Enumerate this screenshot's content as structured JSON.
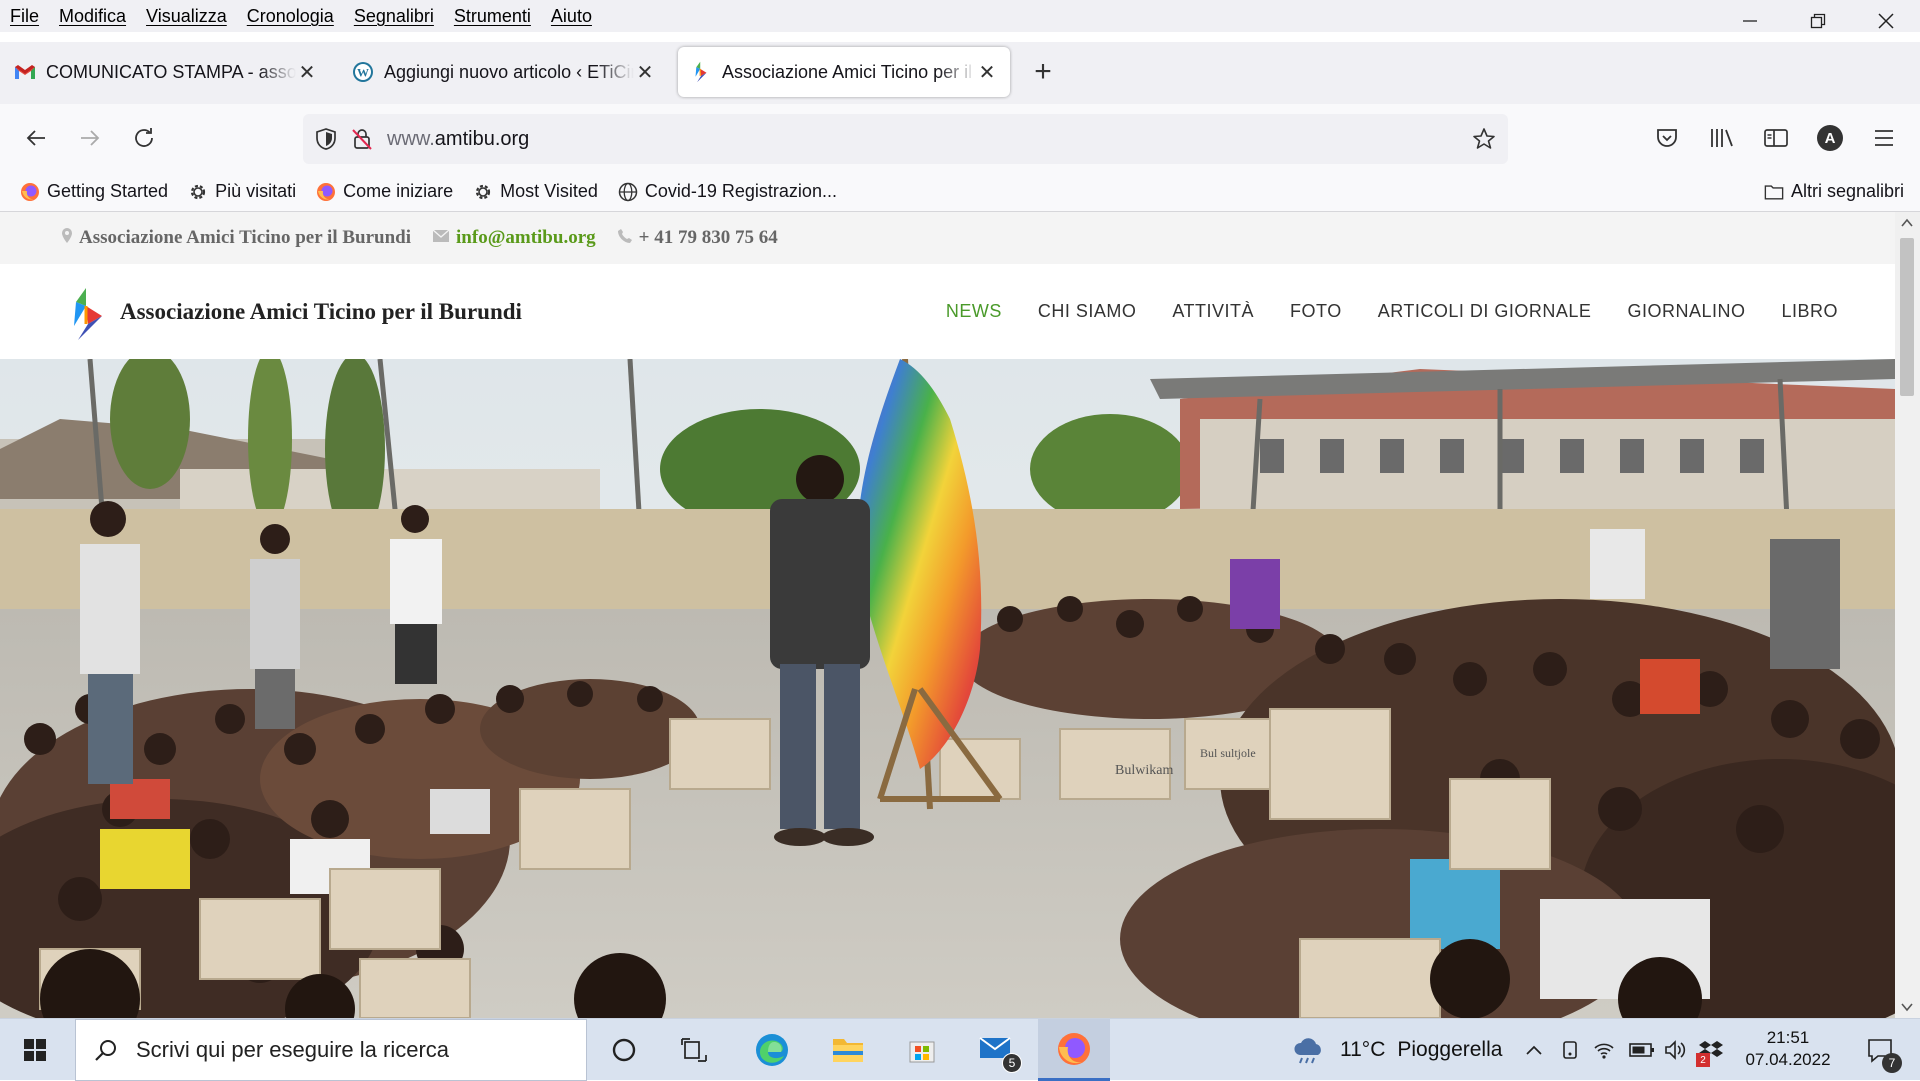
{
  "menu": [
    "File",
    "Modifica",
    "Visualizza",
    "Cronologia",
    "Segnalibri",
    "Strumenti",
    "Aiuto"
  ],
  "window_controls": {
    "minimize": "—",
    "restore": "❐",
    "close": "✕"
  },
  "tabs": [
    {
      "title": "COMUNICATO STAMPA - associ",
      "icon": "gmail-icon",
      "close": "✕"
    },
    {
      "title": "Aggiungi nuovo articolo ‹ ETiCin",
      "icon": "wordpress-icon",
      "close": "✕"
    },
    {
      "title": "Associazione Amici Ticino per il Burundi",
      "icon": "site-logo-icon",
      "close": "✕"
    }
  ],
  "new_tab_label": "+",
  "url": {
    "prefix": "www.",
    "domain": "amtibu.org"
  },
  "bookmarks": [
    {
      "label": "Getting Started",
      "icon": "firefox-icon"
    },
    {
      "label": "Più visitati",
      "icon": "gear-icon"
    },
    {
      "label": "Come iniziare",
      "icon": "firefox-icon"
    },
    {
      "label": "Most Visited",
      "icon": "gear-icon"
    },
    {
      "label": "Covid-19 Registrazion...",
      "icon": "globe-icon"
    }
  ],
  "other_bookmarks": "Altri segnalibri",
  "profile_initial": "A",
  "site": {
    "topinfo": {
      "name": "Associazione Amici Ticino per il Burundi",
      "email": "info@amtibu.org",
      "phone": "+ 41 79 830 75 64"
    },
    "title": "Associazione Amici Ticino per il Burundi",
    "nav": [
      "NEWS",
      "CHI SIAMO",
      "ATTIVITÀ",
      "FOTO",
      "ARTICOLI DI GIORNALE",
      "GIORNALINO",
      "LIBRO"
    ],
    "nav_active": "NEWS",
    "box_labels": [
      "Bulwikam",
      "Bul sultjole"
    ]
  },
  "taskbar": {
    "search_placeholder": "Scrivi qui per eseguire la ricerca",
    "weather": {
      "temp": "11°C",
      "condition": "Pioggerella"
    },
    "time": "21:51",
    "date": "07.04.2022",
    "mail_badge": "5",
    "notif_badge": "7",
    "security_badge": "2"
  }
}
